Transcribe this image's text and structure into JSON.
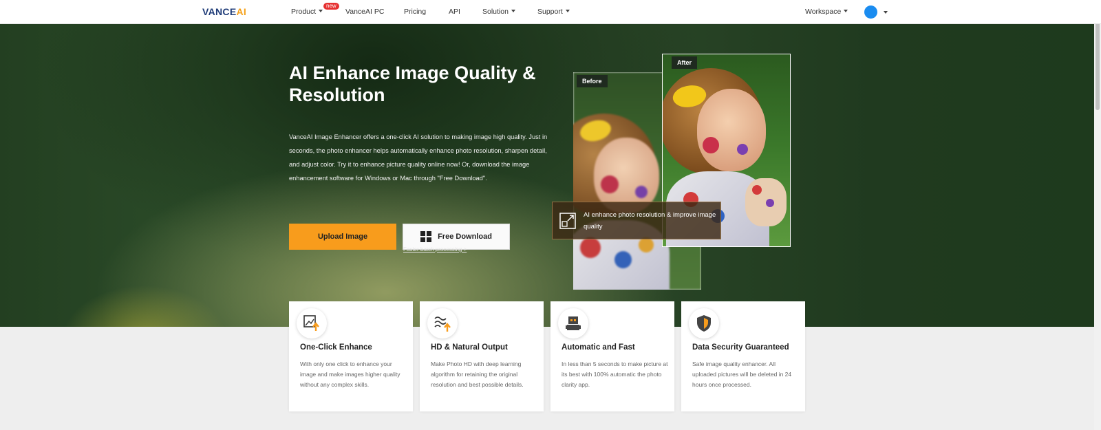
{
  "nav": {
    "logo_part1": "VANCE",
    "logo_part2": "AI",
    "items": [
      {
        "label": "Product"
      },
      {
        "label": "VanceAI PC"
      },
      {
        "label": "Pricing"
      },
      {
        "label": "API"
      },
      {
        "label": "Solution"
      },
      {
        "label": "Support"
      },
      {
        "label": "Workspace"
      }
    ],
    "badge": "new",
    "avatar_color": "#1a8cf0"
  },
  "hero": {
    "title": "AI Enhance Image Quality & Resolution",
    "description": "VanceAI Image Enhancer offers a one-click AI solution to making image high quality. Just in seconds, the photo enhancer helps automatically enhance photo resolution, sharpen detail, and adjust color. Try it to enhance picture quality online now! Or, download the image enhancement software for Windows or Mac through \"Free Download\".",
    "upload_button": "Upload Image",
    "download_button": "Free Download",
    "batch_link": "Faster batch processing >",
    "before_label": "Before",
    "after_label": "After",
    "caption": "AI enhance photo resolution & improve image quality",
    "accent_color": "#f89c1c"
  },
  "features": [
    {
      "icon": "enhance-icon",
      "title": "One-Click Enhance",
      "text": "With only one click to enhance your image and make images higher quality without any complex skills."
    },
    {
      "icon": "hd-output-icon",
      "title": "HD & Natural Output",
      "text": "Make Photo HD with deep learning algorithm for retaining the original resolution and best possible details."
    },
    {
      "icon": "robot-icon",
      "title": "Automatic and Fast",
      "text": "In less than 5 seconds to make picture at its best with 100% automatic the photo clarity app."
    },
    {
      "icon": "shield-icon",
      "title": "Data Security Guaranteed",
      "text": "Safe image quality enhancer. All uploaded pictures will be deleted in 24 hours once processed."
    }
  ]
}
